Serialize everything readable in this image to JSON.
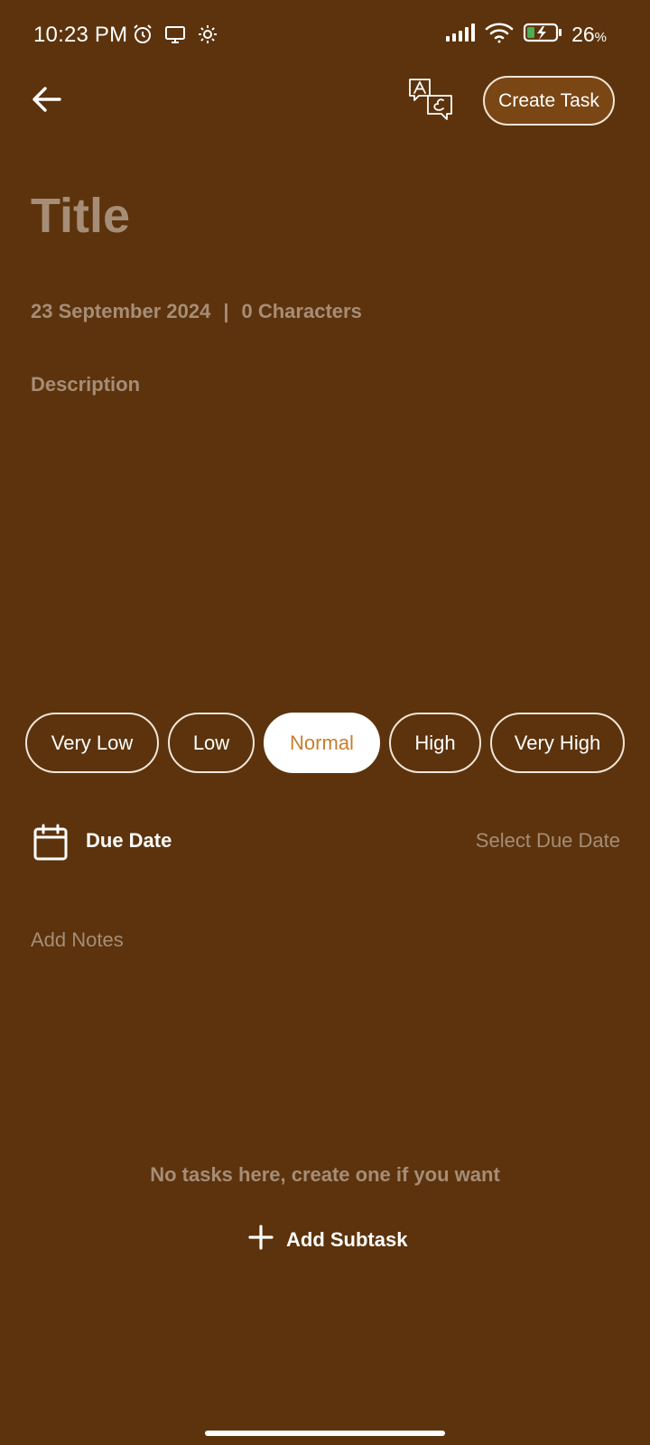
{
  "status_bar": {
    "time": "10:23 PM",
    "icons_left": [
      "alarm-icon",
      "screen-cast-icon",
      "settings-gear-icon"
    ],
    "icons_right": [
      "signal-icon",
      "wifi-icon",
      "battery-charging-icon"
    ],
    "battery_value": "26",
    "battery_unit": "%"
  },
  "top_bar": {
    "back_icon": "arrow-left-icon",
    "translate_icon": "translate-icon",
    "create_label": "Create Task"
  },
  "editor": {
    "title_placeholder": "Title",
    "date": "23 September 2024",
    "separator": "|",
    "char_count": "0 Characters",
    "description_placeholder": "Description"
  },
  "priority": {
    "options": [
      "Very Low",
      "Low",
      "Normal",
      "High",
      "Very High"
    ],
    "selected": "Normal",
    "selected_color": "#c97d2e"
  },
  "due_date": {
    "icon": "calendar-icon",
    "label": "Due Date",
    "action": "Select Due Date"
  },
  "notes": {
    "placeholder": "Add Notes"
  },
  "subtasks": {
    "empty_message": "No tasks here, create one if you want",
    "add_icon": "plus-icon",
    "add_label": "Add Subtask"
  },
  "colors": {
    "background": "#5c330c",
    "muted_text": "#a68d77",
    "button_fill": "#7a4614",
    "accent": "#c97d2e"
  }
}
